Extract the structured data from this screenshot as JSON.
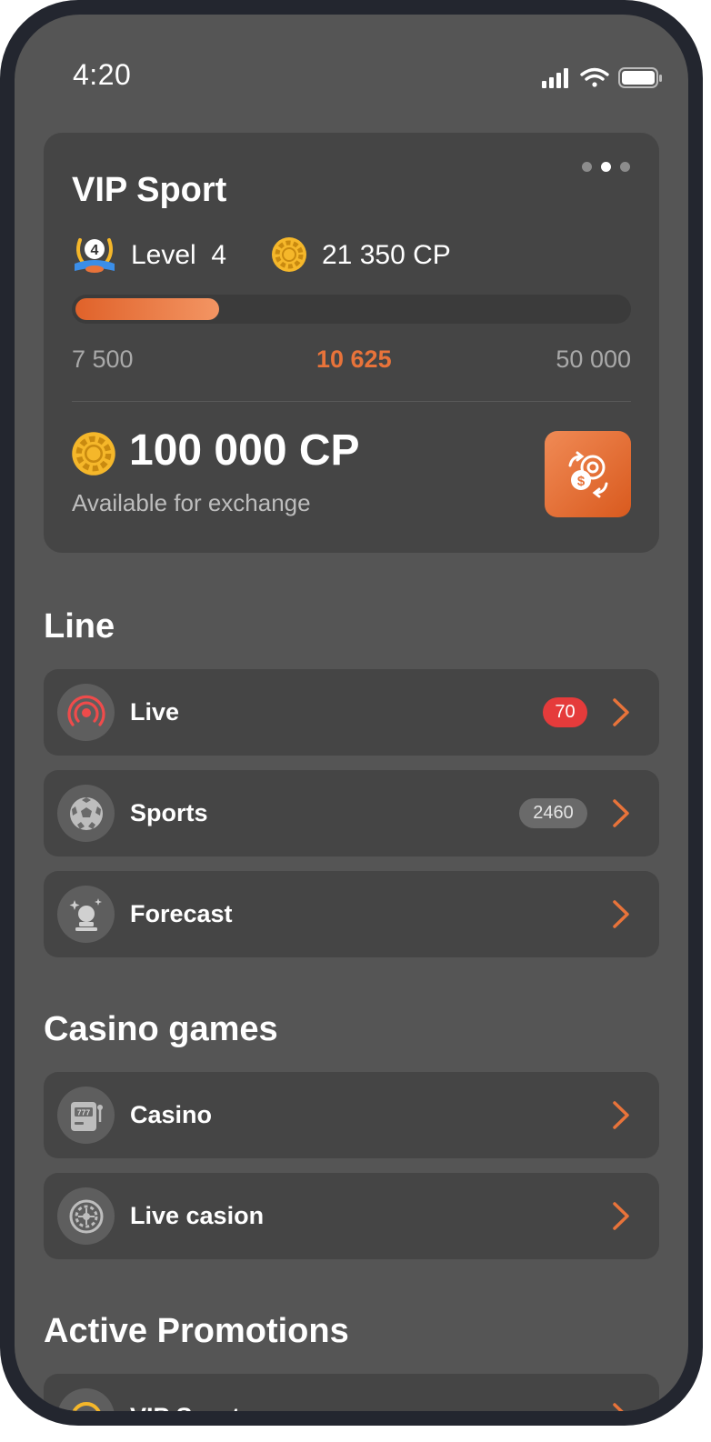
{
  "status_bar": {
    "time": "4:20"
  },
  "vip_card": {
    "title": "VIP Sport",
    "level_label": "Level  4",
    "level_number": "4",
    "cp_balance": "21 350 CP",
    "progress": {
      "fraction": 0.26,
      "min_label": "7 500",
      "current_label": "10 625",
      "max_label": "50 000"
    },
    "exchange_amount": "100 000 CP",
    "exchange_caption": "Available for exchange",
    "pager": {
      "count": 3,
      "active_index": 1
    }
  },
  "sections": {
    "line_title": "Line",
    "casino_title": "Casino games",
    "promotions_title": "Active Promotions"
  },
  "line_items": [
    {
      "label": "Live",
      "badge": "70",
      "icon": "live-broadcast-icon"
    },
    {
      "label": "Sports",
      "badge": "2460",
      "icon": "soccer-ball-icon"
    },
    {
      "label": "Forecast",
      "badge": "",
      "icon": "crystal-ball-icon"
    }
  ],
  "casino_items": [
    {
      "label": "Casino",
      "icon": "slot-machine-icon"
    },
    {
      "label": "Live casion",
      "icon": "roulette-icon"
    }
  ],
  "promotion_items": [
    {
      "label": "VIP Sport",
      "icon": "coin-icon"
    }
  ],
  "colors": {
    "accent": "#e8733a",
    "background": "#555555",
    "card": "#454545",
    "badge_red": "#e53b3b",
    "coin": "#f5b72a"
  }
}
